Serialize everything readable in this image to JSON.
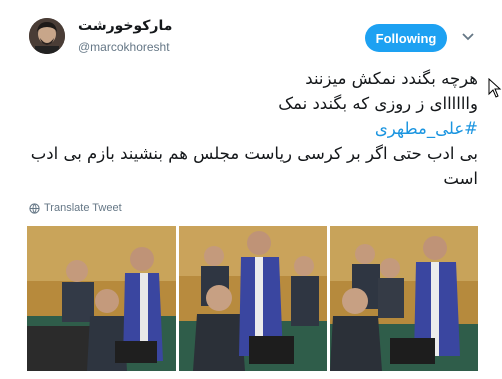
{
  "user": {
    "display_name": "مارکوخورشت",
    "handle": "@marcokhoresht"
  },
  "follow_button": {
    "label": "Following"
  },
  "tweet": {
    "line1": "هرچه بگندد نمکش میزنند",
    "line2": "واااااای ز روزی که بگندد نمک",
    "hashtag": "#علی_مطهری",
    "line3": "بی ادب حتی اگر بر کرسی ریاست مجلس هم بنشیند بازم بی ادب است"
  },
  "translate": {
    "label": "Translate Tweet"
  },
  "icons": {
    "more": "chevron-down-icon",
    "translate": "globe-icon",
    "cursor": "mouse-pointer-icon"
  },
  "colors": {
    "accent": "#1da1f2",
    "hashtag": "#1b95e0",
    "muted": "#657786"
  }
}
